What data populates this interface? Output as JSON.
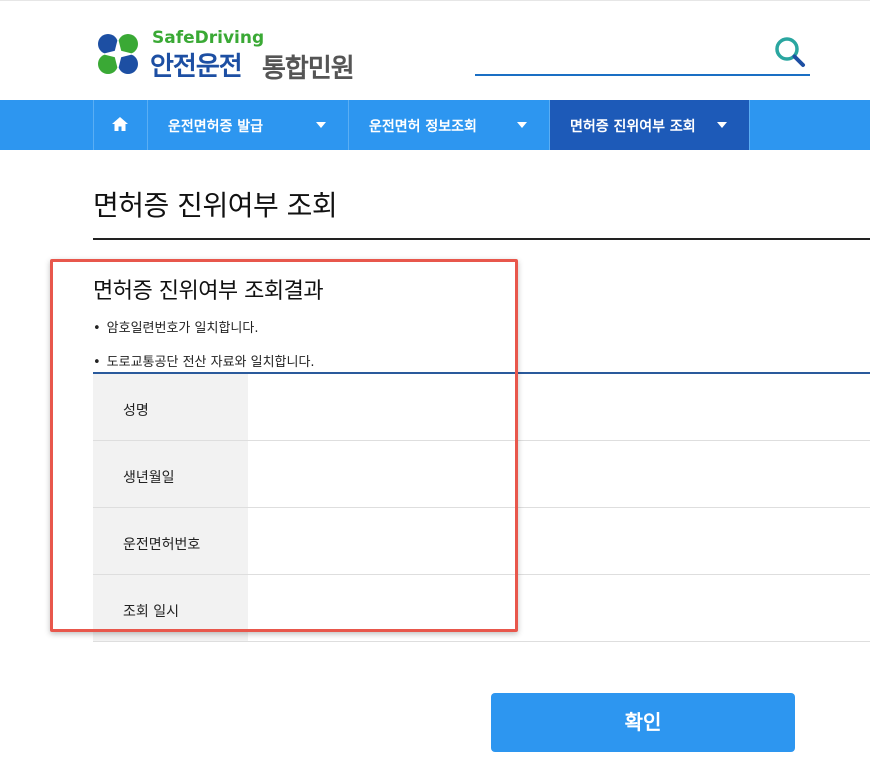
{
  "header": {
    "brand_en": "SafeDriving",
    "brand_ko": "안전운전",
    "brand_sub": "통합민원",
    "search_icon": "search-icon"
  },
  "nav": {
    "home_icon": "home-icon",
    "items": [
      {
        "label": "운전면허증 발급"
      },
      {
        "label": "운전면허 정보조회"
      },
      {
        "label": "면허증 진위여부 조회"
      }
    ]
  },
  "page": {
    "title": "면허증 진위여부 조회",
    "section_title": "면허증 진위여부 조회결과",
    "bullets": [
      "암호일련번호가 일치합니다.",
      "도로교통공단 전산 자료와 일치합니다."
    ],
    "rows": [
      {
        "label": "성명",
        "value": ""
      },
      {
        "label": "생년월일",
        "value": ""
      },
      {
        "label": "운전면허번호",
        "value": ""
      },
      {
        "label": "조회 일시",
        "value": ""
      }
    ],
    "confirm_label": "확인"
  },
  "colors": {
    "nav_bg": "#2d96f0",
    "nav_active": "#1d5ab8",
    "brand_green": "#3aa935",
    "brand_blue": "#1d4fa3",
    "highlight": "#e8574c"
  }
}
